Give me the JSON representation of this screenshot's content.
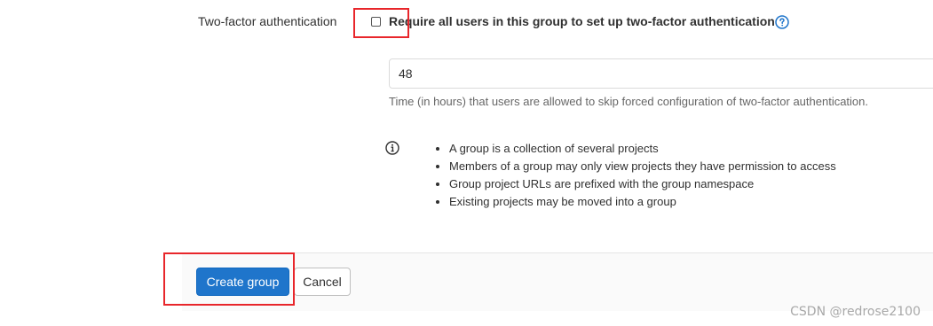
{
  "two_factor": {
    "label": "Two-factor authentication",
    "checkbox_label": "Require all users in this group to set up two-factor authentication",
    "checked": false
  },
  "grace_period": {
    "value": "48",
    "help_text": "Time (in hours) that users are allowed to skip forced configuration of two-factor authentication."
  },
  "info": {
    "items": [
      "A group is a collection of several projects",
      "Members of a group may only view projects they have permission to access",
      "Group project URLs are prefixed with the group namespace",
      "Existing projects may be moved into a group"
    ]
  },
  "actions": {
    "create_label": "Create group",
    "cancel_label": "Cancel"
  },
  "watermark": "CSDN @redrose2100",
  "colors": {
    "primary": "#1f75cb",
    "annotation_red": "#e8262b"
  }
}
